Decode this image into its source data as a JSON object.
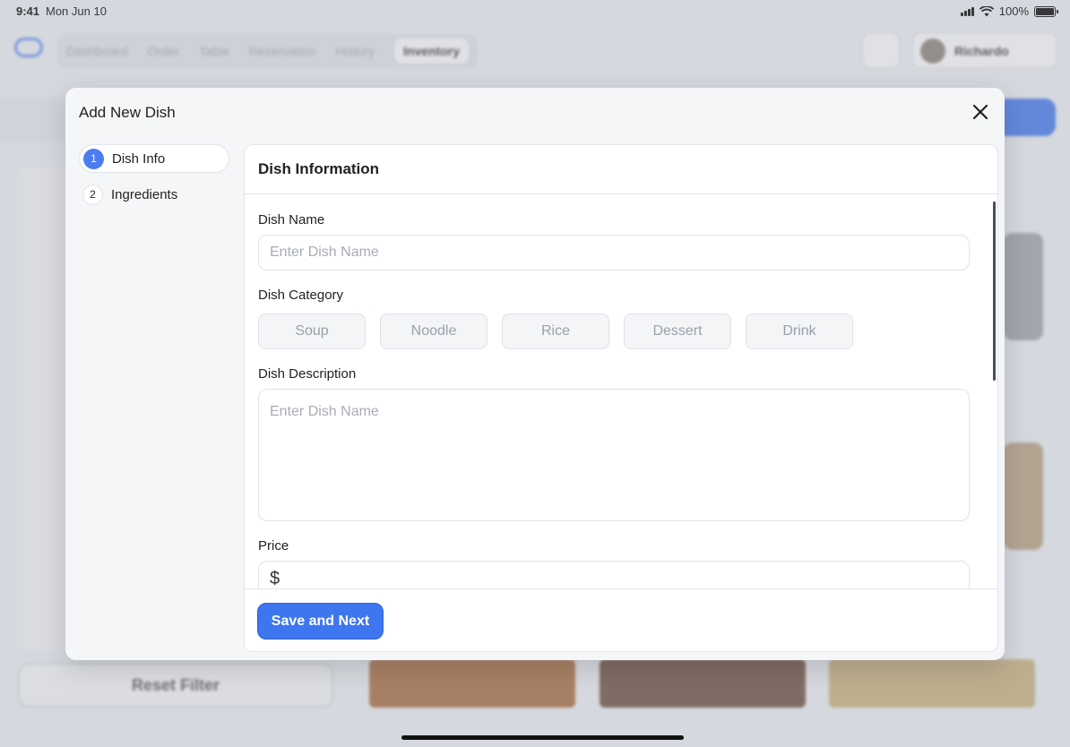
{
  "status_bar": {
    "time": "9:41",
    "date": "Mon Jun 10",
    "battery": "100%"
  },
  "background": {
    "nav": [
      "Dashboard",
      "Order",
      "Table",
      "Reservation",
      "History",
      "Inventory"
    ],
    "user_name": "Richardo",
    "reset_filter": "Reset Filter"
  },
  "modal": {
    "title": "Add New Dish",
    "steps": [
      {
        "num": "1",
        "label": "Dish Info"
      },
      {
        "num": "2",
        "label": "Ingredients"
      }
    ],
    "section_title": "Dish Information",
    "dish_name": {
      "label": "Dish Name",
      "placeholder": "Enter Dish Name"
    },
    "dish_category": {
      "label": "Dish Category",
      "options": [
        "Soup",
        "Noodle",
        "Rice",
        "Dessert",
        "Drink"
      ]
    },
    "dish_description": {
      "label": "Dish Description",
      "placeholder": "Enter Dish Name"
    },
    "price": {
      "label": "Price",
      "currency": "$"
    },
    "save_button": "Save and Next"
  },
  "colors": {
    "accent": "#3e76ef",
    "step_active": "#4b7cf0"
  }
}
